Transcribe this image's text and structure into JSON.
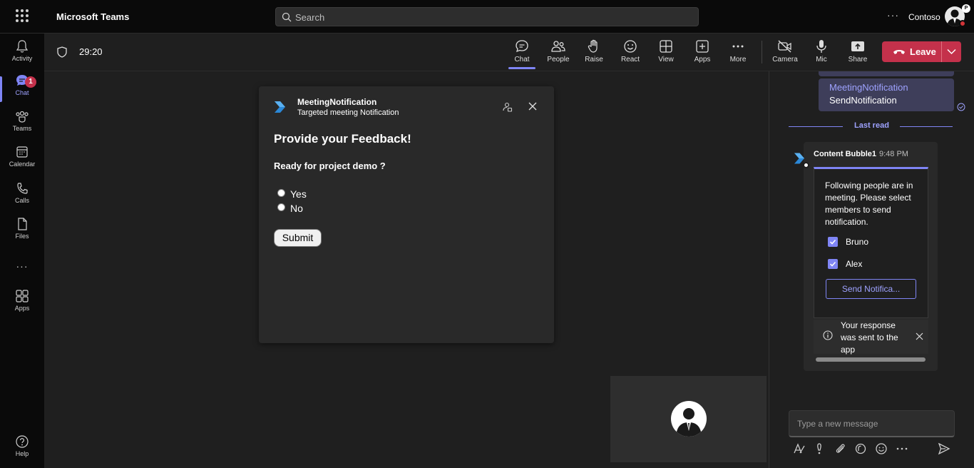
{
  "app": {
    "title": "Microsoft Teams",
    "search_placeholder": "Search",
    "more": "···",
    "org": "Contoso",
    "avatar_badge": "P"
  },
  "rail": {
    "items": [
      {
        "label": "Activity",
        "icon": "bell-icon"
      },
      {
        "label": "Chat",
        "icon": "chat-icon",
        "badge": "1",
        "active": true
      },
      {
        "label": "Teams",
        "icon": "teams-icon"
      },
      {
        "label": "Calendar",
        "icon": "calendar-icon"
      },
      {
        "label": "Calls",
        "icon": "phone-icon"
      },
      {
        "label": "Files",
        "icon": "file-icon"
      },
      {
        "label": "···",
        "icon": "more-icon"
      },
      {
        "label": "Apps",
        "icon": "apps-icon"
      }
    ],
    "help": "Help"
  },
  "meeting": {
    "timer": "29:20",
    "toolbar": [
      {
        "label": "Chat",
        "icon": "chat-icon",
        "active": true
      },
      {
        "label": "People",
        "icon": "people-icon"
      },
      {
        "label": "Raise",
        "icon": "hand-icon"
      },
      {
        "label": "React",
        "icon": "smile-icon"
      },
      {
        "label": "View",
        "icon": "grid-icon"
      },
      {
        "label": "Apps",
        "icon": "plus-box-icon"
      },
      {
        "label": "More",
        "icon": "more-icon"
      },
      {
        "label": "Camera",
        "icon": "camera-off-icon"
      },
      {
        "label": "Mic",
        "icon": "mic-icon"
      },
      {
        "label": "Share",
        "icon": "share-icon"
      }
    ],
    "leave": "Leave",
    "leave_color": "#c4314b"
  },
  "dialog": {
    "title": "MeetingNotification",
    "subtitle": "Targeted meeting Notification",
    "heading": "Provide your Feedback!",
    "question": "Ready for project demo ?",
    "options": [
      "Yes",
      "No"
    ],
    "submit": "Submit"
  },
  "chat": {
    "prev_message": {
      "line1": "MeetingNotification",
      "line2": "SendNotification"
    },
    "last_read": "Last read",
    "bubble": {
      "name": "Content Bubble1",
      "time": "9:48 PM",
      "text": "Following people are in meeting. Please select members to send notification.",
      "members": [
        "Bruno",
        "Alex"
      ],
      "button": "Send Notifica...",
      "response": "Your response was sent to the app"
    },
    "compose_placeholder": "Type a new message"
  },
  "colors": {
    "accent": "#7f85f5",
    "accent_text": "#9ea2ff",
    "background": "#1f1f1f",
    "rail": "#0a0a0a"
  }
}
